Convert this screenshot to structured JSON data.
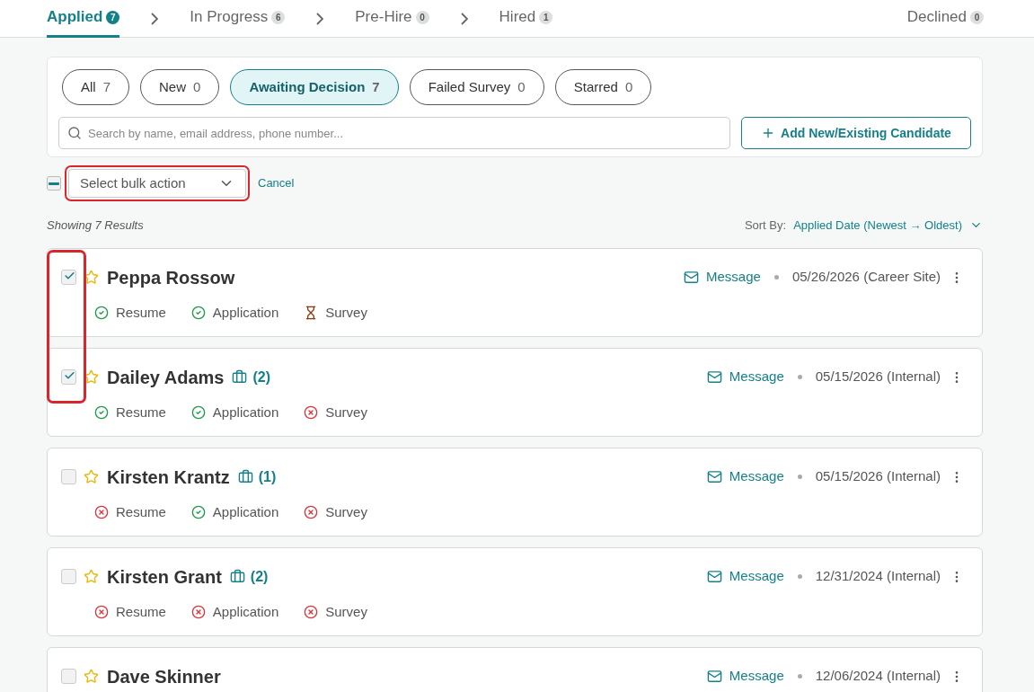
{
  "stages": [
    {
      "label": "Applied",
      "count": "7",
      "selected": true
    },
    {
      "label": "In Progress",
      "count": "6",
      "selected": false
    },
    {
      "label": "Pre-Hire",
      "count": "0",
      "selected": false
    },
    {
      "label": "Hired",
      "count": "1",
      "selected": false
    }
  ],
  "declined": {
    "label": "Declined",
    "count": "0",
    "selected": false
  },
  "filters": [
    {
      "label": "All",
      "count": "7",
      "selected": false
    },
    {
      "label": "New",
      "count": "0",
      "selected": false
    },
    {
      "label": "Awaiting Decision",
      "count": "7",
      "selected": true
    },
    {
      "label": "Failed Survey",
      "count": "0",
      "selected": false
    },
    {
      "label": "Starred",
      "count": "0",
      "selected": false
    }
  ],
  "search": {
    "placeholder": "Search by name, email address, phone number..."
  },
  "add_button": "Add New/Existing Candidate",
  "bulk": {
    "indeterminate": true,
    "placeholder": "Select bulk action",
    "highlighted": true,
    "cancel": "Cancel"
  },
  "results_label": "Showing 7 Results",
  "sort": {
    "label": "Sort By:",
    "value": "Applied Date (Newest → Oldest)"
  },
  "candidates": [
    {
      "name": "Peppa Rossow",
      "checked": true,
      "highlighted": true,
      "starred": false,
      "message": "Message",
      "date": "05/26/2026 (Career Site)",
      "statuses": [
        {
          "label": "Resume",
          "kind": "done"
        },
        {
          "label": "Application",
          "kind": "done"
        },
        {
          "label": "Survey",
          "kind": "pending"
        }
      ]
    },
    {
      "name": "Dailey Adams",
      "checked": true,
      "highlighted": true,
      "starred": false,
      "jobs": "(2)",
      "message": "Message",
      "date": "05/15/2026 (Internal)",
      "statuses": [
        {
          "label": "Resume",
          "kind": "done"
        },
        {
          "label": "Application",
          "kind": "done"
        },
        {
          "label": "Survey",
          "kind": "failed"
        }
      ]
    },
    {
      "name": "Kirsten Krantz",
      "checked": false,
      "highlighted": false,
      "starred": false,
      "jobs": "(1)",
      "message": "Message",
      "date": "05/15/2026 (Internal)",
      "statuses": [
        {
          "label": "Resume",
          "kind": "failed"
        },
        {
          "label": "Application",
          "kind": "done"
        },
        {
          "label": "Survey",
          "kind": "failed"
        }
      ]
    },
    {
      "name": "Kirsten Grant",
      "checked": false,
      "highlighted": false,
      "starred": false,
      "jobs": "(2)",
      "message": "Message",
      "date": "12/31/2024 (Internal)",
      "statuses": [
        {
          "label": "Resume",
          "kind": "failed"
        },
        {
          "label": "Application",
          "kind": "failed"
        },
        {
          "label": "Survey",
          "kind": "failed"
        }
      ]
    },
    {
      "name": "Dave Skinner",
      "checked": false,
      "highlighted": false,
      "starred": false,
      "message": "Message",
      "date": "12/06/2024 (Internal)"
    }
  ]
}
